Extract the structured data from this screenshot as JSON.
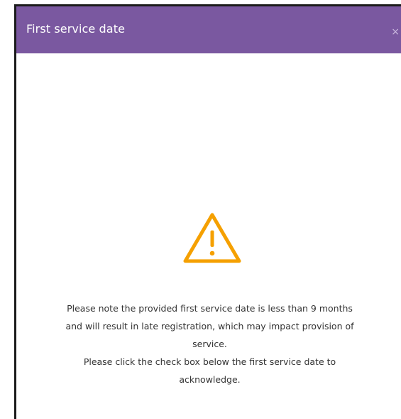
{
  "dialog": {
    "title": "First service date",
    "close_label": "×",
    "warning_icon": "warning-triangle-icon",
    "warning_color": "#f5a000",
    "header_color": "#7a58a0",
    "message": {
      "line1": "Please note the provided first service date is less than 9 months",
      "line2": "and will result in late registration, which may impact provision of",
      "line3": "service.",
      "line4": "Please click the check box below the first service date to",
      "line5": "acknowledge."
    }
  }
}
